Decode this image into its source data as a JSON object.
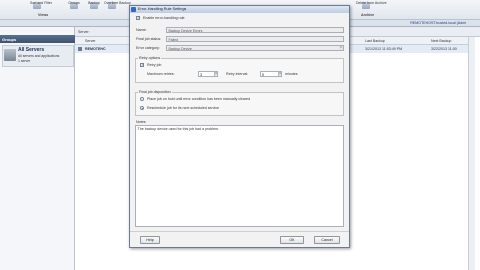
{
  "ribbon": {
    "buttons": [
      "Sort and Filter",
      "Groups",
      "Backup",
      "Overtime Backup",
      "Delete from Archive"
    ],
    "groups": [
      "Views",
      "Archive"
    ]
  },
  "status": {
    "server": "REMOTEHOST.trusted.local (Admi"
  },
  "left": {
    "header": "Groups",
    "all_servers": "All Servers",
    "all_servers_sub": "All servers and applications",
    "all_servers_count": "1 server"
  },
  "table": {
    "filter_label": "Server:",
    "headers": [
      "Server",
      "Last Backup",
      "Next Backup"
    ],
    "row": {
      "server": "REMOTEHC",
      "last": "3/21/2013 11:53:49 PM",
      "next": "3/22/2013 11:00"
    }
  },
  "dialog": {
    "title": "Error-Handling Rule Settings",
    "enable_label": "Enable error-handling rule",
    "name_label": "Name:",
    "name_value": "Backup Device Errors",
    "status_label": "Final job status:",
    "status_value": "Failed",
    "category_label": "Error category:",
    "category_value": "Backup Device",
    "retry_group": "Retry options",
    "retry_job": "Retry job",
    "max_retries_label": "Maximum retries:",
    "max_retries_value": "3",
    "interval_label": "Retry interval:",
    "interval_value": "5",
    "minutes": "minutes",
    "final_group": "Final job disposition",
    "opt_hold": "Place job on hold until error condition has been manually cleared",
    "opt_reschedule": "Reschedule job for its next scheduled service",
    "notes_label": "Notes:",
    "notes_value": "The backup device used for this job had a problem.",
    "help": "Help",
    "ok": "OK",
    "cancel": "Cancel"
  }
}
